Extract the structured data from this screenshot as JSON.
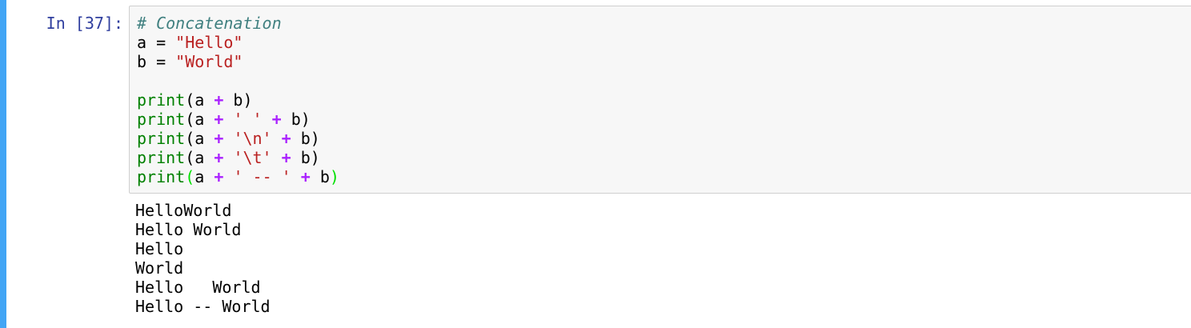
{
  "cell": {
    "prompt": "In [37]:",
    "code_lines": [
      [
        {
          "t": "# Concatenation",
          "c": "comment"
        }
      ],
      [
        {
          "t": "a",
          "c": "name"
        },
        {
          "t": " = ",
          "c": "plain"
        },
        {
          "t": "\"Hello\"",
          "c": "string"
        }
      ],
      [
        {
          "t": "b",
          "c": "name"
        },
        {
          "t": " = ",
          "c": "plain"
        },
        {
          "t": "\"World\"",
          "c": "string"
        }
      ],
      [],
      [
        {
          "t": "print",
          "c": "builtin"
        },
        {
          "t": "(a ",
          "c": "plain"
        },
        {
          "t": "+",
          "c": "op"
        },
        {
          "t": " b)",
          "c": "plain"
        }
      ],
      [
        {
          "t": "print",
          "c": "builtin"
        },
        {
          "t": "(a ",
          "c": "plain"
        },
        {
          "t": "+",
          "c": "op"
        },
        {
          "t": " ",
          "c": "plain"
        },
        {
          "t": "' '",
          "c": "string"
        },
        {
          "t": " ",
          "c": "plain"
        },
        {
          "t": "+",
          "c": "op"
        },
        {
          "t": " b)",
          "c": "plain"
        }
      ],
      [
        {
          "t": "print",
          "c": "builtin"
        },
        {
          "t": "(a ",
          "c": "plain"
        },
        {
          "t": "+",
          "c": "op"
        },
        {
          "t": " ",
          "c": "plain"
        },
        {
          "t": "'\\n'",
          "c": "string"
        },
        {
          "t": " ",
          "c": "plain"
        },
        {
          "t": "+",
          "c": "op"
        },
        {
          "t": " b)",
          "c": "plain"
        }
      ],
      [
        {
          "t": "print",
          "c": "builtin"
        },
        {
          "t": "(a ",
          "c": "plain"
        },
        {
          "t": "+",
          "c": "op"
        },
        {
          "t": " ",
          "c": "plain"
        },
        {
          "t": "'\\t'",
          "c": "string"
        },
        {
          "t": " ",
          "c": "plain"
        },
        {
          "t": "+",
          "c": "op"
        },
        {
          "t": " b)",
          "c": "plain"
        }
      ],
      [
        {
          "t": "print",
          "c": "builtin"
        },
        {
          "t": "(",
          "c": "bracket-match"
        },
        {
          "t": "a ",
          "c": "plain"
        },
        {
          "t": "+",
          "c": "op"
        },
        {
          "t": " ",
          "c": "plain"
        },
        {
          "t": "' -- '",
          "c": "string"
        },
        {
          "t": " ",
          "c": "plain"
        },
        {
          "t": "+",
          "c": "op"
        },
        {
          "t": " b",
          "c": "plain"
        },
        {
          "t": ")",
          "c": "bracket-match"
        }
      ]
    ],
    "output_lines": [
      "HelloWorld",
      "Hello World",
      "Hello",
      "World",
      "Hello\tWorld",
      "Hello -- World"
    ]
  },
  "colors": {
    "selection_bar": "#42a5f5",
    "prompt": "#303f9f",
    "comment": "#408080",
    "string": "#ba2121",
    "builtin": "#008000",
    "operator": "#aa22ff",
    "bracket_match": "#00e000",
    "input_background": "#f7f7f7",
    "input_border": "#cfcfcf"
  }
}
